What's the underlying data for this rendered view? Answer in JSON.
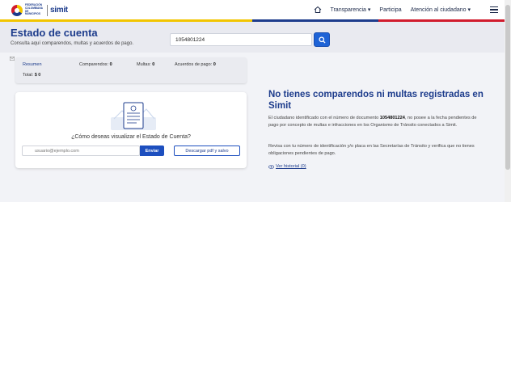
{
  "nav": {
    "logo_text": "FEDERACIÓN COLOMBIANA DE MUNICIPIOS",
    "logo_brand": "simit",
    "items": [
      {
        "label": "Transparencia ▾"
      },
      {
        "label": "Participa"
      },
      {
        "label": "Atención al ciudadano ▾"
      }
    ],
    "stripe_colors": [
      "#f2c500",
      "#1d3c8c",
      "#d11b2d"
    ]
  },
  "header": {
    "title": "Estado de cuenta",
    "subtitle": "Consulta aquí comparendos, multas y acuerdos de pago.",
    "search_value": "1054801224",
    "search_icon": "search-icon"
  },
  "summary": {
    "resumen_label": "Resumen",
    "comparendos_label": "Comparendos:",
    "comparendos_value": "0",
    "multas_label": "Multas:",
    "multas_value": "0",
    "acuerdos_label": "Acuerdos de pago:",
    "acuerdos_value": "0",
    "total_label": "Total:",
    "total_value": "$ 0"
  },
  "visual": {
    "question": "¿Cómo deseas visualizar el Estado de Cuenta?",
    "email_placeholder": "usuario@ejemplo.com",
    "send_label": "Enviar",
    "download_label": "Descargar pdf y salvo"
  },
  "result": {
    "title": "No tienes comparendos ni multas registradas en Simit",
    "p1_before": "El ciudadano identificado con el número de documento ",
    "p1_doc": "1054801224",
    "p1_after": ", no posee a la fecha pendientes de pago por concepto de multas e infracciones en los Organismo de Tránsito conectados a Simit.",
    "p2": "Revisa con tu número de identificación y/o placa en las Secretarías de Tránsito y verifica que no tienes obligaciones pendientes de pago.",
    "history_link": "Ver historial (0)"
  },
  "colors": {
    "brand_blue": "#1d3c8c",
    "button_blue": "#1e63d6",
    "page_bg": "#f2f3f7"
  }
}
